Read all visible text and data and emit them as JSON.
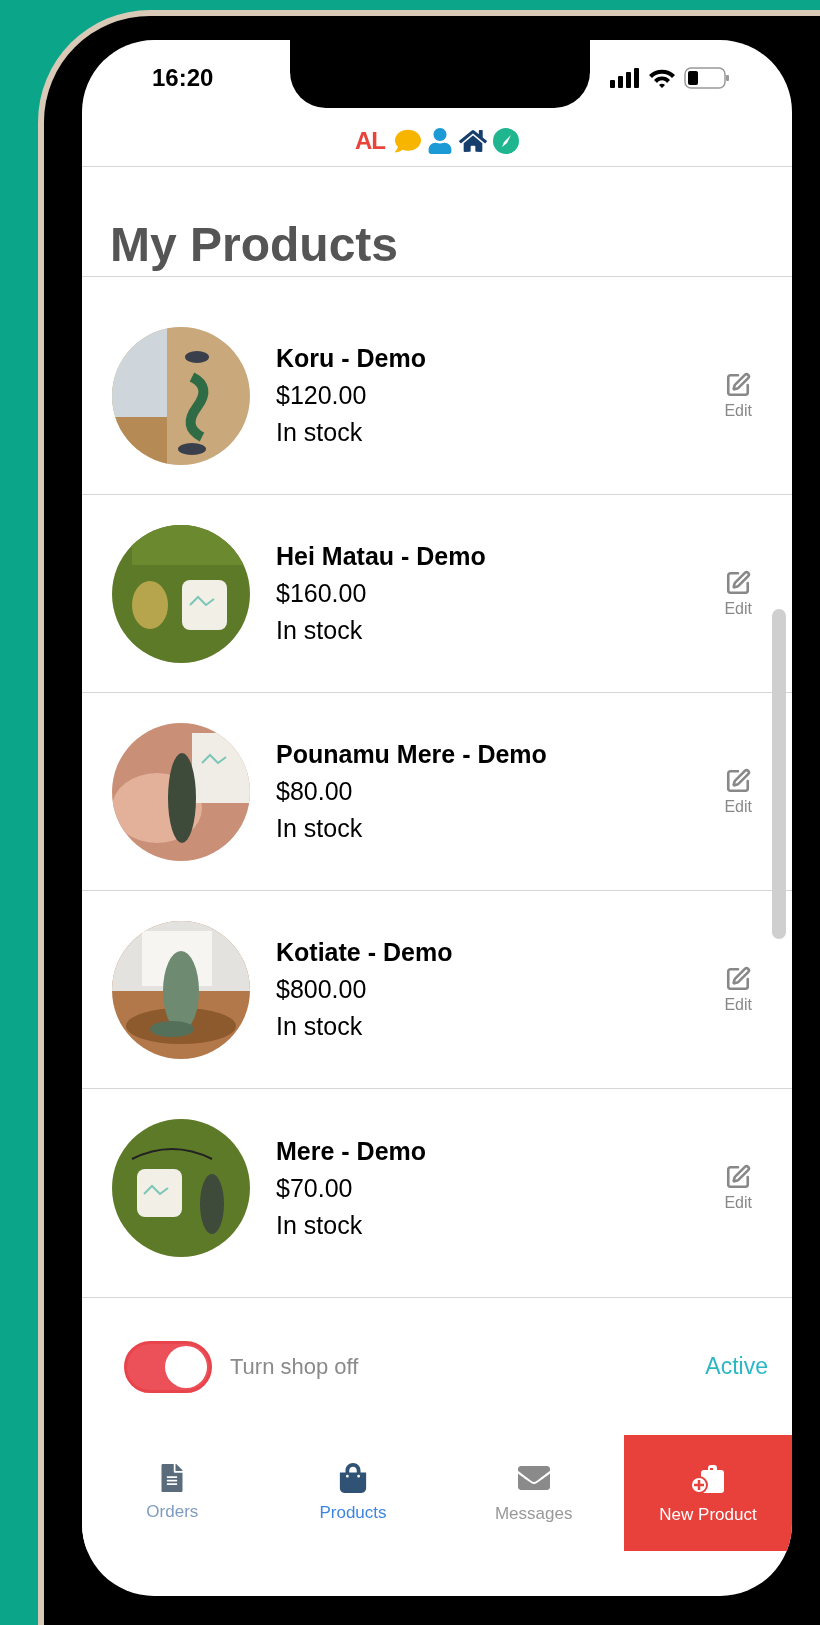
{
  "status_bar": {
    "time": "16:20"
  },
  "brand": {
    "logo_text": "AL"
  },
  "title": "My Products",
  "products": [
    {
      "name": "Koru - Demo",
      "price": "$120.00",
      "stock": "In stock",
      "edit": "Edit"
    },
    {
      "name": "Hei Matau - Demo",
      "price": "$160.00",
      "stock": "In stock",
      "edit": "Edit"
    },
    {
      "name": "Pounamu Mere - Demo",
      "price": "$80.00",
      "stock": "In stock",
      "edit": "Edit"
    },
    {
      "name": "Kotiate - Demo",
      "price": "$800.00",
      "stock": "In stock",
      "edit": "Edit"
    },
    {
      "name": "Mere - Demo",
      "price": "$70.00",
      "stock": "In stock",
      "edit": "Edit"
    }
  ],
  "shop_toggle": {
    "on": true,
    "label": "Turn shop off",
    "status": "Active"
  },
  "tabs": [
    {
      "kind": "orders",
      "label": "Orders",
      "selected": false
    },
    {
      "kind": "products",
      "label": "Products",
      "selected": true
    },
    {
      "kind": "messages",
      "label": "Messages",
      "selected": false
    },
    {
      "kind": "new_product",
      "label": "New Product"
    }
  ]
}
